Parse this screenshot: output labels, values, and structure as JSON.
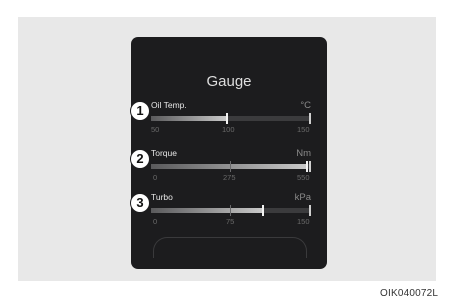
{
  "title": "Gauge",
  "caption": "OIK040072L",
  "gauges": [
    {
      "number": "1",
      "label": "Oil Temp.",
      "unit": "°C",
      "scale": [
        "50",
        "100",
        "150"
      ],
      "fill_fraction": 0.48
    },
    {
      "number": "2",
      "label": "Torque",
      "unit": "Nm",
      "scale": [
        "0",
        "275",
        "550"
      ],
      "fill_fraction": 0.99
    },
    {
      "number": "3",
      "label": "Turbo",
      "unit": "kPa",
      "scale": [
        "0",
        "75",
        "150"
      ],
      "fill_fraction": 0.71
    }
  ]
}
